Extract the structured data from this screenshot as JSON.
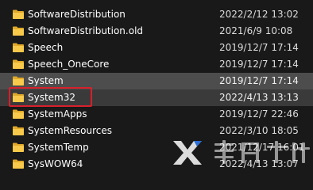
{
  "files": [
    {
      "name": "SoftwareDistribution",
      "date": "2022/2/12 13:02"
    },
    {
      "name": "SoftwareDistribution.old",
      "date": "2021/6/9 10:08"
    },
    {
      "name": "Speech",
      "date": "2019/12/7 17:14"
    },
    {
      "name": "Speech_OneCore",
      "date": "2019/12/7 17:14"
    },
    {
      "name": "System",
      "date": "2019/12/7 17:14"
    },
    {
      "name": "System32",
      "date": "2022/4/13 13:13"
    },
    {
      "name": "SystemApps",
      "date": "2019/12/7 22:46"
    },
    {
      "name": "SystemResources",
      "date": "2022/3/10 18:05"
    },
    {
      "name": "SystemTemp",
      "date": "2021/12/17 16:01"
    },
    {
      "name": "SysWOW64",
      "date": "2022/4/13 13:07"
    }
  ],
  "selected_name": "System",
  "hovered_name": "System32",
  "highlighted_name": "System32",
  "colors": {
    "folder": "#f8c94a",
    "folder_dark": "#e0a92a",
    "selection": "#4d4d4d",
    "hover": "#3a3a3a",
    "highlight_box": "#d8202c"
  },
  "watermark": {
    "icon": "x-logo-icon"
  }
}
